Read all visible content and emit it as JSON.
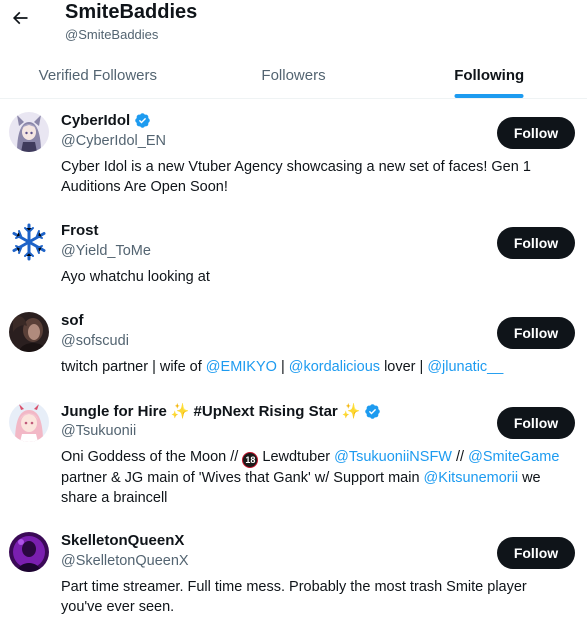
{
  "header": {
    "back_icon": "arrow-left-icon",
    "title": "SmiteBaddies",
    "subtitle": "@SmiteBaddies"
  },
  "tabs": [
    {
      "label": "Verified Followers",
      "active": false
    },
    {
      "label": "Followers",
      "active": false
    },
    {
      "label": "Following",
      "active": true
    }
  ],
  "colors": {
    "accent": "#1d9bf0",
    "button_bg": "#0f1419",
    "secondary_text": "#536471"
  },
  "users": [
    {
      "name": "CyberIdol",
      "verified": true,
      "handle": "@CyberIdol_EN",
      "follow_label": "Follow",
      "bio": [
        {
          "text": "Cyber Idol is a new Vtuber Agency showcasing a new set of faces! Gen 1 Auditions Are Open Soon!"
        }
      ]
    },
    {
      "name": "Frost",
      "verified": false,
      "handle": "@Yield_ToMe",
      "follow_label": "Follow",
      "bio": [
        {
          "text": "Ayo whatchu looking at"
        }
      ]
    },
    {
      "name": "sof",
      "verified": false,
      "handle": "@sofscudi",
      "follow_label": "Follow",
      "bio": [
        {
          "text": "twitch partner | wife of "
        },
        {
          "text": "@EMIKYO",
          "link": true
        },
        {
          "text": " | "
        },
        {
          "text": "@kordalicious",
          "link": true
        },
        {
          "text": " lover | "
        },
        {
          "text": "@jlunatic__",
          "link": true
        }
      ]
    },
    {
      "name": "Jungle for Hire",
      "name_extra": "#UpNext Rising Star",
      "verified": true,
      "handle": "@Tsukuonii",
      "follow_label": "Follow",
      "bio": [
        {
          "text": "Oni Goddess of the Moon // "
        },
        {
          "text": "18",
          "badge": true
        },
        {
          "text": " Lewdtuber "
        },
        {
          "text": "@TsukuoniiNSFW",
          "link": true
        },
        {
          "text": " // "
        },
        {
          "text": "@SmiteGame",
          "link": true
        },
        {
          "text": " partner & JG main of 'Wives that Gank' w/ Support main "
        },
        {
          "text": "@Kitsunemorii",
          "link": true
        },
        {
          "text": " we share a braincell"
        }
      ]
    },
    {
      "name": "SkelletonQueenX",
      "verified": false,
      "handle": "@SkelletonQueenX",
      "follow_label": "Follow",
      "bio": [
        {
          "text": "Part time streamer. Full time mess. Probably the most trash Smite player you've ever seen."
        }
      ]
    }
  ]
}
